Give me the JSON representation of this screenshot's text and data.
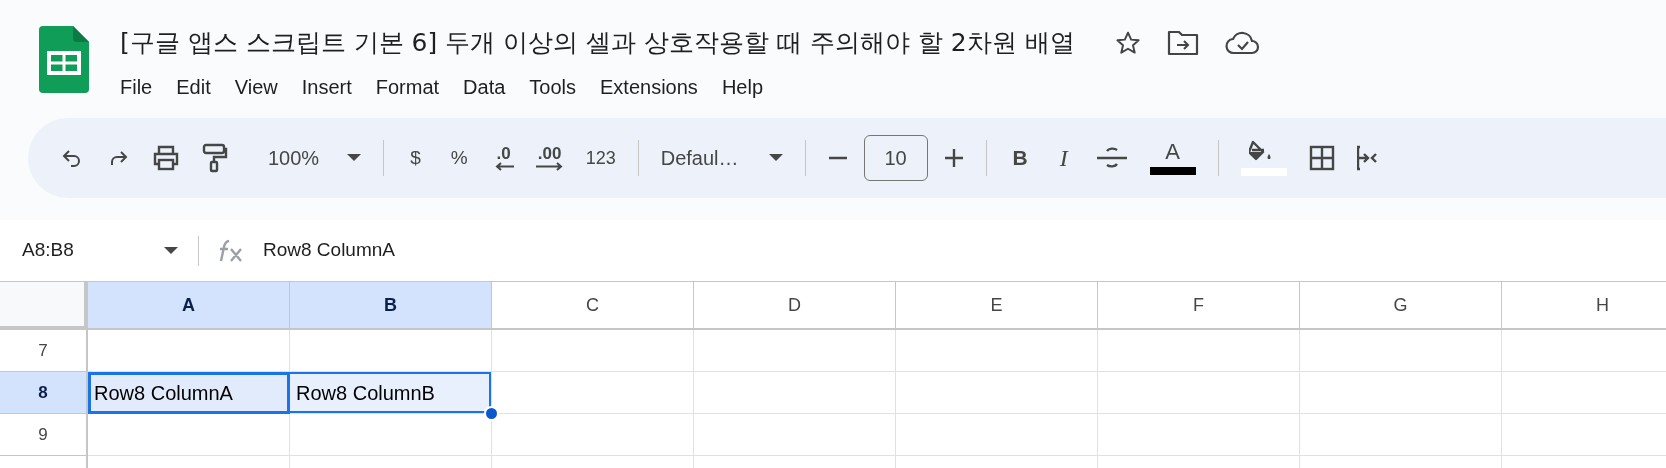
{
  "title": "[구글 앱스 스크립트 기본 6] 두개 이상의 셀과 상호작용할 때 주의해야 할 2차원 배열",
  "menu": [
    "File",
    "Edit",
    "View",
    "Insert",
    "Format",
    "Data",
    "Tools",
    "Extensions",
    "Help"
  ],
  "toolbar": {
    "zoom": "100%",
    "currency": "$",
    "percent": "%",
    "decrease_decimal": ".0",
    "increase_decimal": ".00",
    "number_format": "123",
    "font": "Defaul…",
    "font_size": "10",
    "bold": "B",
    "italic": "I",
    "text_color": {
      "label": "A",
      "color": "#000000"
    },
    "fill_color": {
      "color": "#ffffff"
    }
  },
  "name_box": "A8:B8",
  "formula": "Row8 ColumnA",
  "columns": [
    {
      "label": "A",
      "selected": true
    },
    {
      "label": "B",
      "selected": true
    },
    {
      "label": "C",
      "selected": false
    },
    {
      "label": "D",
      "selected": false
    },
    {
      "label": "E",
      "selected": false
    },
    {
      "label": "F",
      "selected": false
    },
    {
      "label": "G",
      "selected": false
    },
    {
      "label": "H",
      "selected": false
    }
  ],
  "rows": [
    {
      "label": "7",
      "selected": false,
      "cells": [
        {
          "selected": false
        },
        {
          "selected": false
        }
      ]
    },
    {
      "label": "8",
      "selected": true,
      "cells": [
        {
          "text": "Row8 ColumnA",
          "selected": true,
          "active": true
        },
        {
          "text": "Row8 ColumnB",
          "selected": true,
          "active": false
        }
      ]
    },
    {
      "label": "9",
      "selected": false,
      "cells": [
        {
          "selected": false
        },
        {
          "selected": false
        }
      ]
    }
  ]
}
